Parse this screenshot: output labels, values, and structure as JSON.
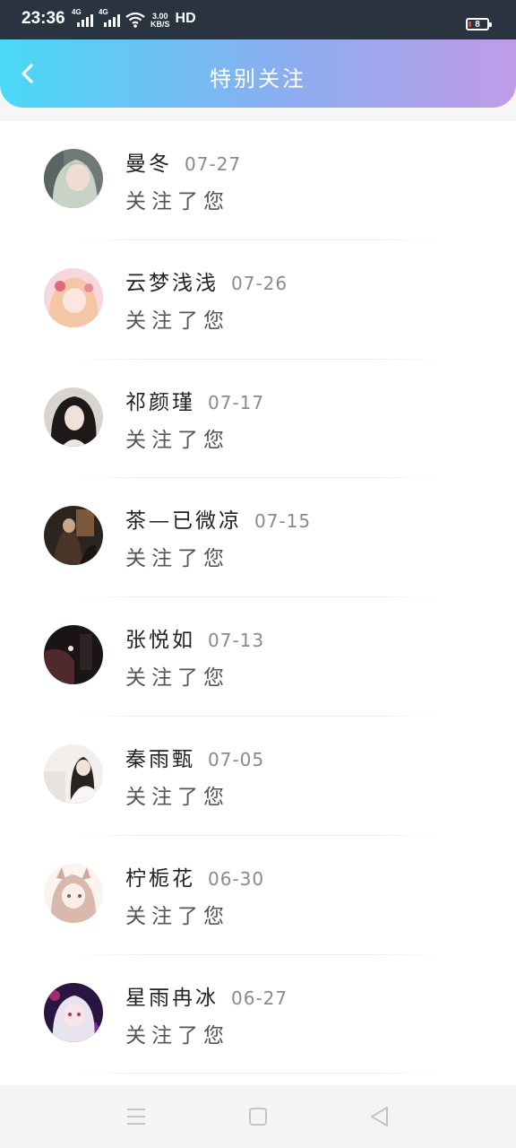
{
  "status_bar": {
    "time": "23:36",
    "signal_1_label": "4G",
    "signal_2_label": "4G",
    "net_speed_value": "3.00",
    "net_speed_unit": "KB/S",
    "hd_label": "HD",
    "battery_level": "8"
  },
  "header": {
    "title": "特别关注",
    "back_icon": "chevron-left-icon",
    "gradient_start": "#4ad8f7",
    "gradient_end": "#c09be8"
  },
  "list": {
    "items": [
      {
        "name": "曼冬",
        "date": "07-27",
        "action": "关注了您"
      },
      {
        "name": "云梦浅浅",
        "date": "07-26",
        "action": "关注了您"
      },
      {
        "name": "祁颜瑾",
        "date": "07-17",
        "action": "关注了您"
      },
      {
        "name": "茶—已微凉",
        "date": "07-15",
        "action": "关注了您"
      },
      {
        "name": "张悦如",
        "date": "07-13",
        "action": "关注了您"
      },
      {
        "name": "秦雨甄",
        "date": "07-05",
        "action": "关注了您"
      },
      {
        "name": "柠栀花",
        "date": "06-30",
        "action": "关注了您"
      },
      {
        "name": "星雨冉冰",
        "date": "06-27",
        "action": "关注了您"
      }
    ]
  },
  "nav_bar": {
    "menu_icon": "menu-icon",
    "home_icon": "home-square-icon",
    "back_icon": "back-triangle-icon"
  }
}
